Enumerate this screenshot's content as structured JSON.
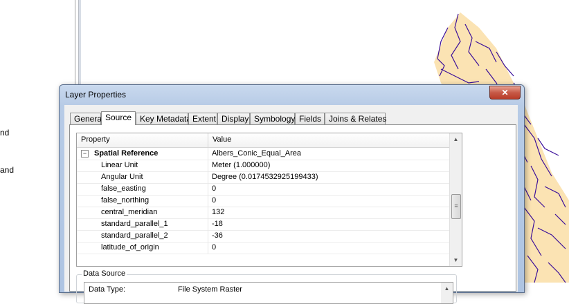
{
  "background": {
    "toc_snippets": [
      "nd",
      "and"
    ]
  },
  "dialog": {
    "title": "Layer Properties",
    "close_label": "✕",
    "tabs": [
      {
        "label": "General"
      },
      {
        "label": "Source"
      },
      {
        "label": "Key Metadata"
      },
      {
        "label": "Extent"
      },
      {
        "label": "Display"
      },
      {
        "label": "Symbology"
      },
      {
        "label": "Fields"
      },
      {
        "label": "Joins & Relates"
      }
    ],
    "active_tab": "Source",
    "grid": {
      "headers": [
        "Property",
        "Value"
      ],
      "group": {
        "label": "Spatial Reference",
        "value": "Albers_Conic_Equal_Area",
        "expander": "−"
      },
      "rows": [
        {
          "key": "Linear Unit",
          "value": "Meter (1.000000)"
        },
        {
          "key": "Angular Unit",
          "value": "Degree (0.0174532925199433)"
        },
        {
          "key": "false_easting",
          "value": "0"
        },
        {
          "key": "false_northing",
          "value": "0"
        },
        {
          "key": "central_meridian",
          "value": "132"
        },
        {
          "key": "standard_parallel_1",
          "value": "-18"
        },
        {
          "key": "standard_parallel_2",
          "value": "-36"
        },
        {
          "key": "latitude_of_origin",
          "value": "0"
        }
      ]
    },
    "data_source": {
      "legend": "Data Source",
      "rows": [
        {
          "key": "Data Type:",
          "value": "File System Raster"
        }
      ]
    }
  },
  "colors": {
    "river": "#3b0f9a",
    "land": "#fbe3b3"
  }
}
